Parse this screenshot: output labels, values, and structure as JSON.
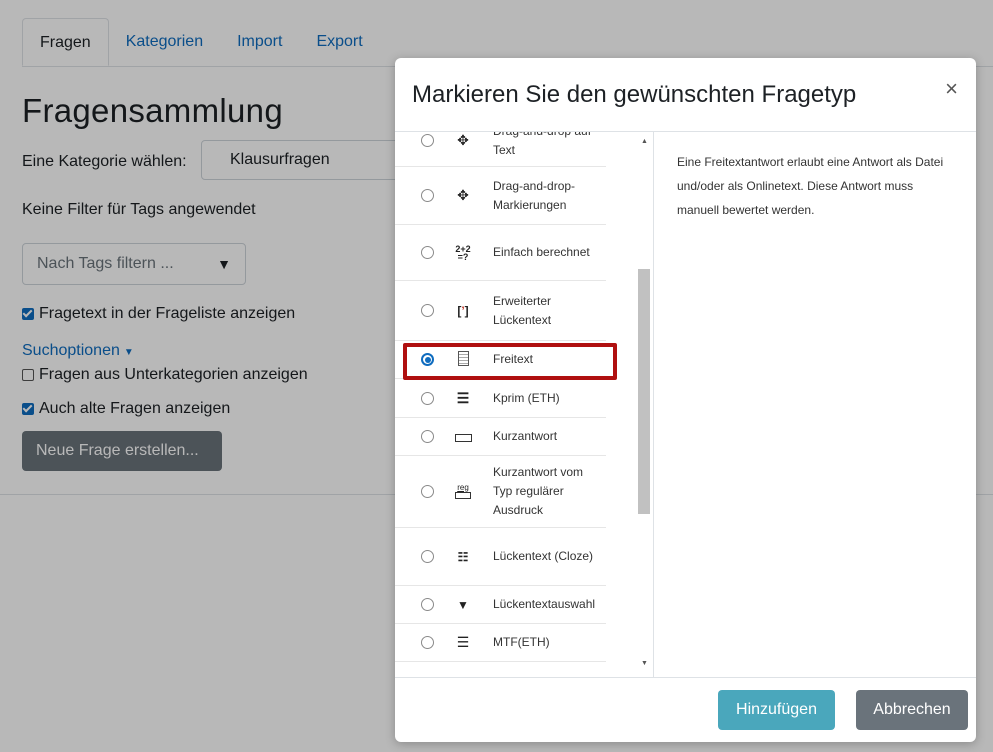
{
  "tabs": [
    {
      "label": "Fragen",
      "active": true
    },
    {
      "label": "Kategorien",
      "active": false
    },
    {
      "label": "Import",
      "active": false
    },
    {
      "label": "Export",
      "active": false
    }
  ],
  "page": {
    "title": "Fragensammlung",
    "category_label": "Eine Kategorie wählen:",
    "category_value": "Klausurfragen",
    "no_tag_filter": "Keine Filter für Tags angewendet",
    "tag_filter_placeholder": "Nach Tags filtern ...",
    "show_question_text": "Fragetext in der Frageliste anzeigen",
    "show_question_text_checked": true,
    "search_options": "Suchoptionen",
    "show_subcategories": "Fragen aus Unterkategorien anzeigen",
    "show_subcategories_checked": false,
    "show_old": "Auch alte Fragen anzeigen",
    "show_old_checked": true,
    "new_question_button": "Neue Frage erstellen..."
  },
  "modal": {
    "title": "Markieren Sie den gewünschten Fragetyp",
    "close_symbol": "×",
    "options": [
      {
        "label": "Drag-and-drop auf Text",
        "icon": "move-icon",
        "selected": false
      },
      {
        "label": "Drag-and-drop-Markierungen",
        "icon": "move-icon",
        "selected": false
      },
      {
        "label": "Einfach berechnet",
        "icon": "calculated-icon",
        "selected": false
      },
      {
        "label": "Erweiterter Lückentext",
        "icon": "gapfill-icon",
        "selected": false
      },
      {
        "label": "Freitext",
        "icon": "essay-icon",
        "selected": true
      },
      {
        "label": "Kprim (ETH)",
        "icon": "kprim-icon",
        "selected": false
      },
      {
        "label": "Kurzantwort",
        "icon": "shortanswer-icon",
        "selected": false
      },
      {
        "label": "Kurzantwort vom Typ regulärer Ausdruck",
        "icon": "regexp-icon",
        "selected": false
      },
      {
        "label": "Lückentext (Cloze)",
        "icon": "cloze-icon",
        "selected": false
      },
      {
        "label": "Lückentextauswahl",
        "icon": "dropdown-icon",
        "selected": false
      },
      {
        "label": "MTF(ETH)",
        "icon": "mtf-icon",
        "selected": false
      }
    ],
    "description": "Eine Freitextantwort erlaubt eine Antwort als Datei und/oder als Onlinetext. Diese Antwort muss manuell bewertet werden.",
    "add_button": "Hinzufügen",
    "cancel_button": "Abbrechen"
  },
  "colors": {
    "link": "#0f6cbf",
    "primary_button": "#4aa7bc",
    "secondary_button": "#6a737b",
    "highlight_box": "#b01010"
  }
}
